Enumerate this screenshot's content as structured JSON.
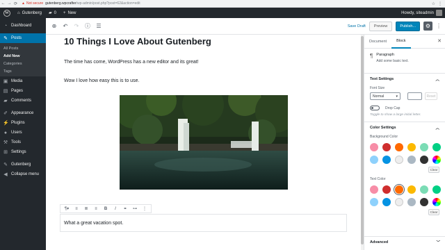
{
  "browser": {
    "security_label": "Not secure",
    "url_host": "gutenberg.wpcrafter",
    "url_path": "/wp-admin/post.php?post=62&action=edit"
  },
  "admin_bar": {
    "site_name": "Gutenberg",
    "comments_count": "0",
    "new_label": "New",
    "greeting": "Howdy, siteadmin"
  },
  "sidebar": {
    "items": [
      {
        "label": "Dashboard",
        "icon": "dashboard-icon"
      },
      {
        "label": "Posts",
        "icon": "pin-icon"
      },
      {
        "label": "Media",
        "icon": "media-icon"
      },
      {
        "label": "Pages",
        "icon": "page-icon"
      },
      {
        "label": "Comments",
        "icon": "comment-icon"
      },
      {
        "label": "Appearance",
        "icon": "brush-icon"
      },
      {
        "label": "Plugins",
        "icon": "plug-icon"
      },
      {
        "label": "Users",
        "icon": "user-icon"
      },
      {
        "label": "Tools",
        "icon": "wrench-icon"
      },
      {
        "label": "Settings",
        "icon": "settings-icon"
      },
      {
        "label": "Gutenberg",
        "icon": "pencil-icon"
      },
      {
        "label": "Collapse menu",
        "icon": "collapse-icon"
      }
    ],
    "posts_submenu": [
      "All Posts",
      "Add New",
      "Categories",
      "Tags"
    ]
  },
  "editor_header": {
    "save_draft": "Save Draft",
    "preview": "Preview",
    "publish": "Publish..."
  },
  "content": {
    "title": "10 Things I Love About Gutenberg",
    "paragraph_1": "The time has come, WordPress has a new editor and its great!",
    "paragraph_2": "Wow I love how easy this is to use.",
    "caption_paragraph": "What a great vacation spot."
  },
  "panel": {
    "tabs": [
      "Document",
      "Block"
    ],
    "active_tab": "Block",
    "block_name": "Paragraph",
    "block_desc": "Add some basic text.",
    "text_settings": "Text Settings",
    "font_size_label": "Font Size",
    "font_size_value": "Normal",
    "reset_label": "Reset",
    "drop_cap_label": "Drop Cap",
    "drop_cap_help": "Toggle to show a large initial letter.",
    "color_settings": "Color Settings",
    "background_color_label": "Background Color",
    "text_color_label": "Text Color",
    "clear_label": "Clear",
    "advanced": "Advanced",
    "palette": [
      "#f78da7",
      "#cf2e2e",
      "#ff6900",
      "#fcb900",
      "#7bdcb5",
      "#00d084",
      "#8ed1fc",
      "#0693e3",
      "#eeeeee",
      "#abb8c3",
      "#313131",
      "gradient"
    ]
  }
}
